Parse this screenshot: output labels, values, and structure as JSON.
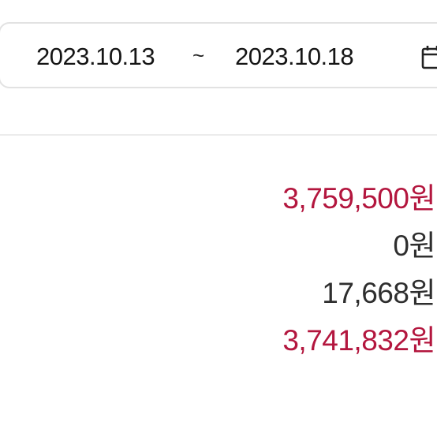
{
  "date_filter": {
    "start_date": "2023.10.13",
    "separator": "~",
    "end_date": "2023.10.18"
  },
  "summary": {
    "rows": [
      {
        "amount": "3,759,500원",
        "color": "#b3163e"
      },
      {
        "amount": "0원",
        "color": "#2e2e2e"
      },
      {
        "amount": "17,668원",
        "color": "#2e2e2e"
      },
      {
        "amount": "3,741,832원",
        "color": "#b3163e"
      }
    ]
  },
  "icons": {
    "calendar": "calendar-icon"
  }
}
